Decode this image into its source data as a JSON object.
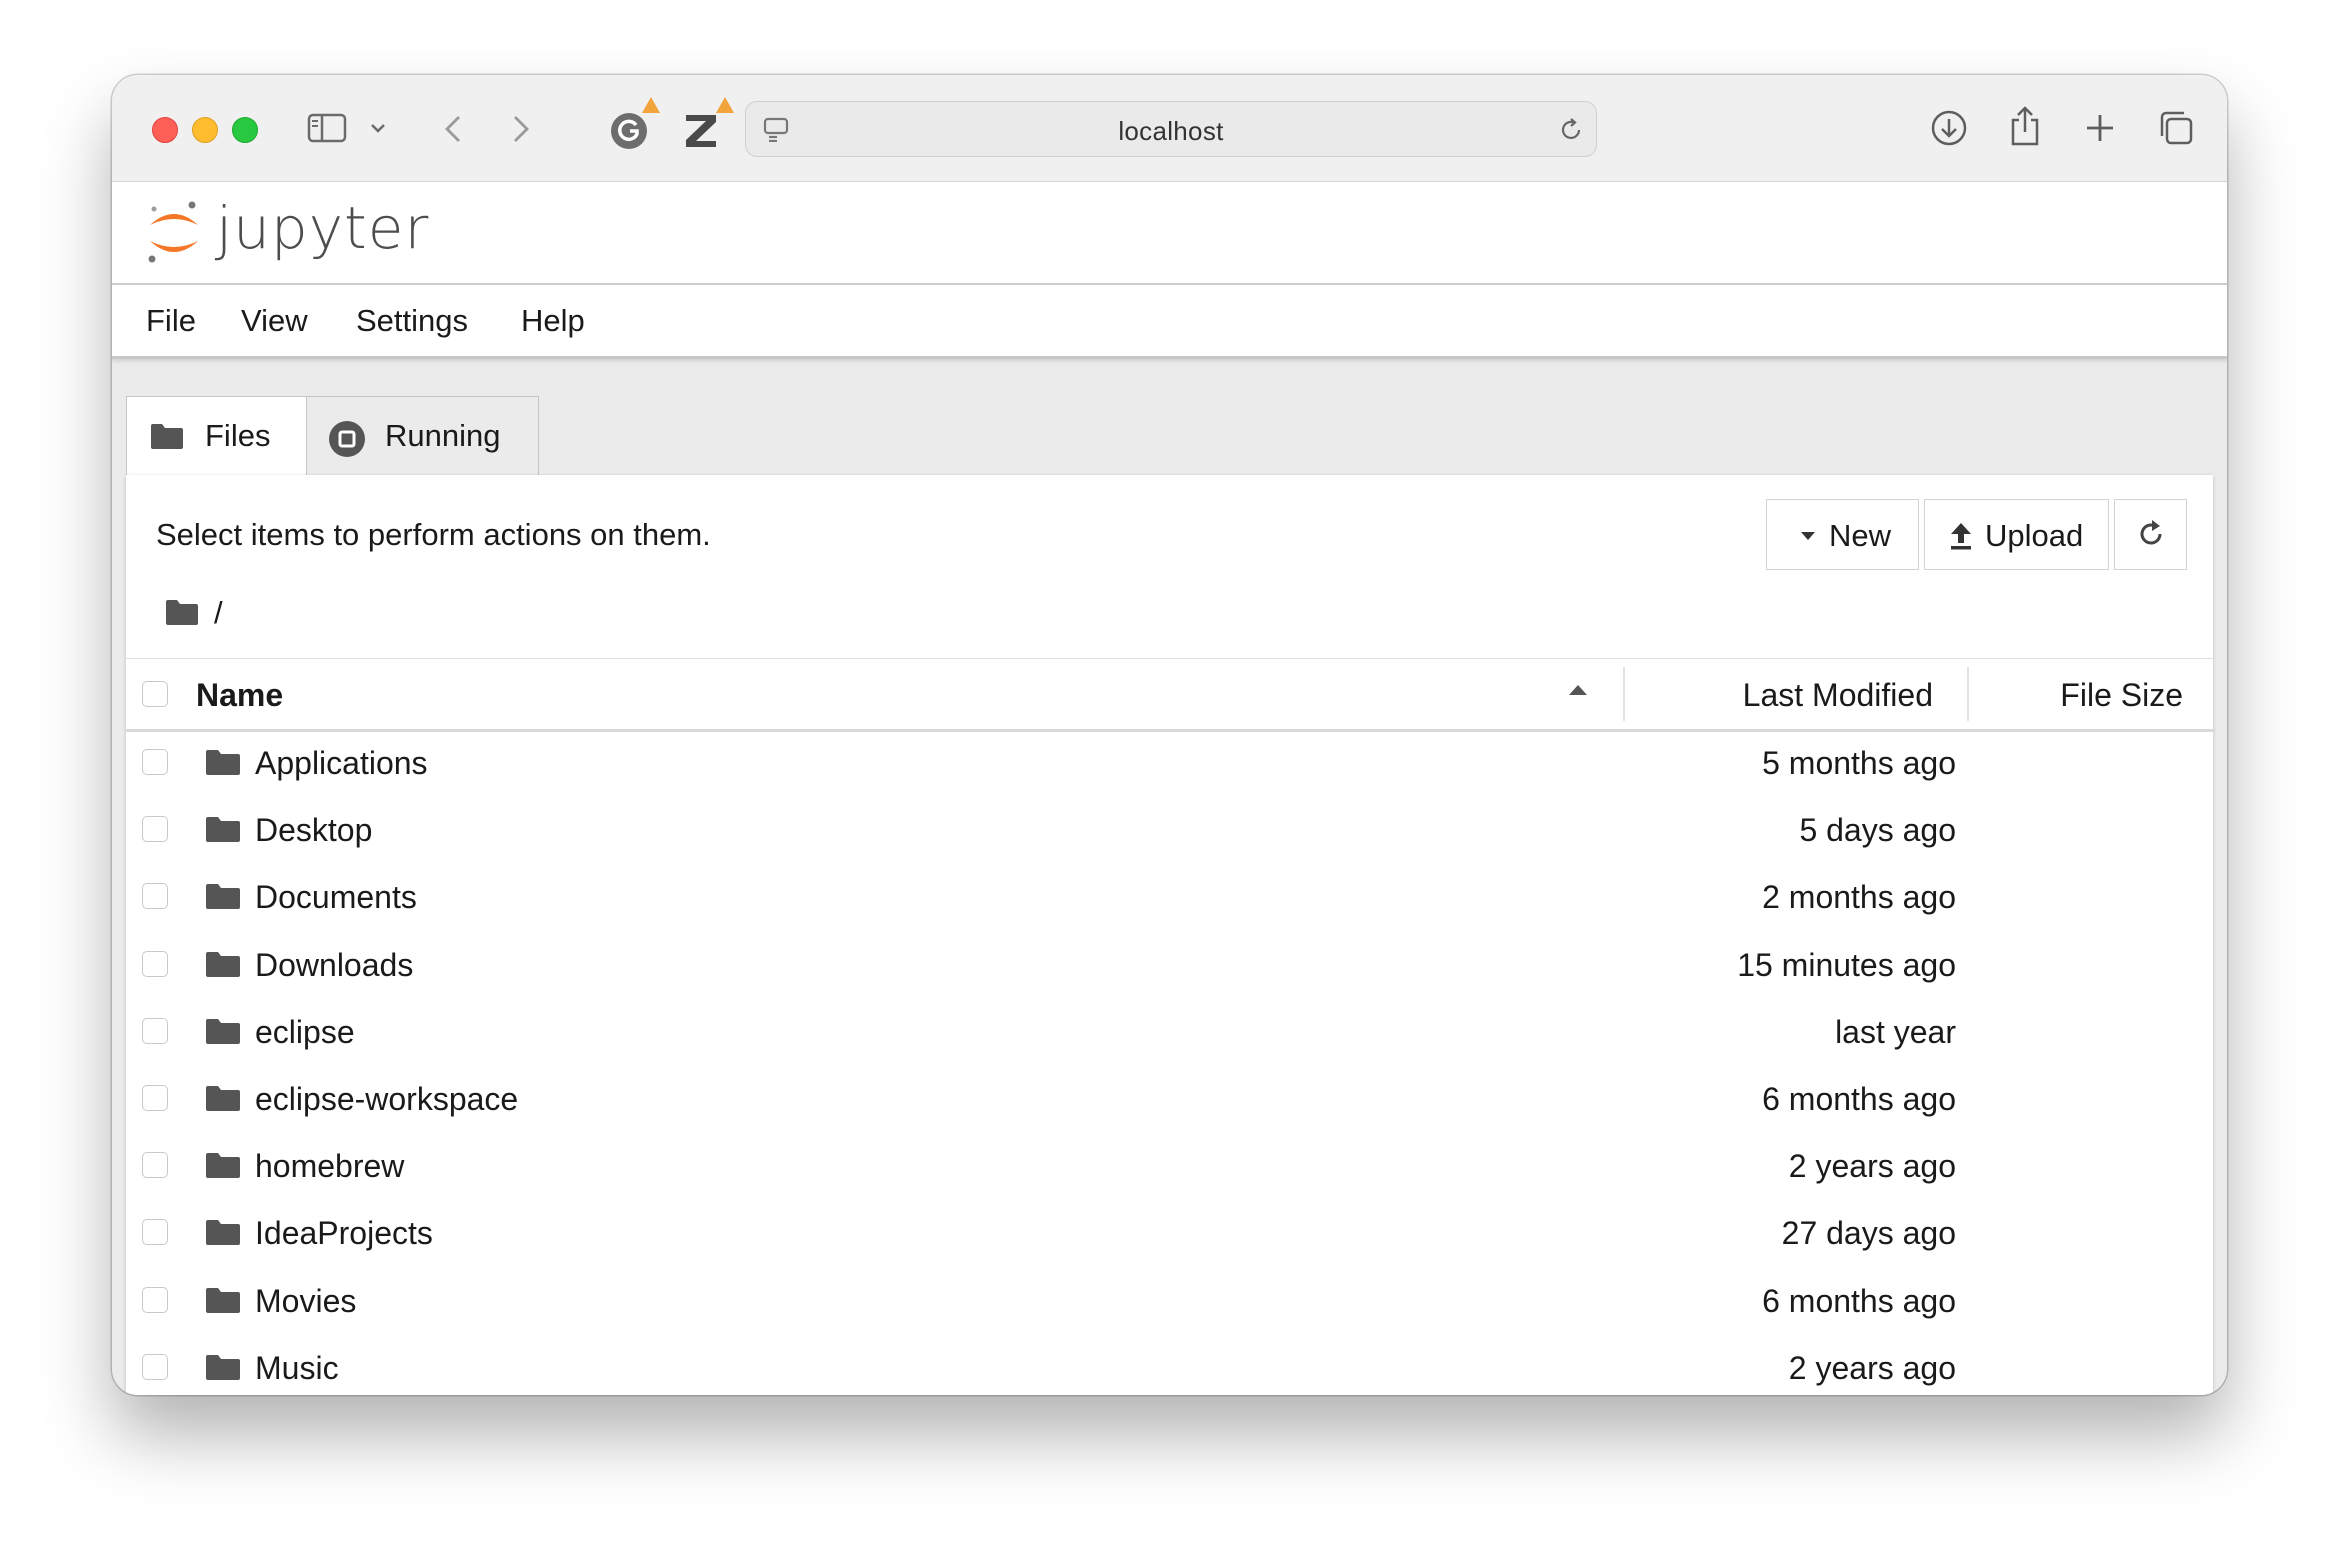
{
  "browser": {
    "url": "localhost",
    "colors": {
      "close": "#fe5f57",
      "minimize": "#febc2e",
      "zoom": "#28c840",
      "warning": "#f2a43c"
    },
    "icons": [
      "sidebar-icon",
      "chevron-down-icon",
      "back-icon",
      "forward-icon",
      "grammarly-extension-icon",
      "zotero-extension-icon",
      "site-settings-icon",
      "reload-icon",
      "download-icon",
      "share-icon",
      "new-tab-icon",
      "tab-overview-icon"
    ]
  },
  "app": {
    "logo_text": "jupyter",
    "brand_color": "#f37726"
  },
  "menu": [
    "File",
    "View",
    "Settings",
    "Help"
  ],
  "tabs": [
    {
      "label": "Files",
      "icon": "folder-icon",
      "active": true
    },
    {
      "label": "Running",
      "icon": "stop-circle-icon",
      "active": false
    }
  ],
  "toolbar": {
    "hint": "Select items to perform actions on them.",
    "new_label": "New",
    "upload_label": "Upload",
    "refresh_icon": "refresh-icon"
  },
  "breadcrumb": {
    "path": "/"
  },
  "table": {
    "columns": {
      "name": "Name",
      "modified": "Last Modified",
      "size": "File Size"
    },
    "sort": {
      "column": "Name",
      "direction": "ascending"
    },
    "rows": [
      {
        "name": "Applications",
        "modified": "5 months ago",
        "type": "folder"
      },
      {
        "name": "Desktop",
        "modified": "5 days ago",
        "type": "folder"
      },
      {
        "name": "Documents",
        "modified": "2 months ago",
        "type": "folder"
      },
      {
        "name": "Downloads",
        "modified": "15 minutes ago",
        "type": "folder"
      },
      {
        "name": "eclipse",
        "modified": "last year",
        "type": "folder"
      },
      {
        "name": "eclipse-workspace",
        "modified": "6 months ago",
        "type": "folder"
      },
      {
        "name": "homebrew",
        "modified": "2 years ago",
        "type": "folder"
      },
      {
        "name": "IdeaProjects",
        "modified": "27 days ago",
        "type": "folder"
      },
      {
        "name": "Movies",
        "modified": "6 months ago",
        "type": "folder"
      },
      {
        "name": "Music",
        "modified": "2 years ago",
        "type": "folder"
      }
    ]
  }
}
